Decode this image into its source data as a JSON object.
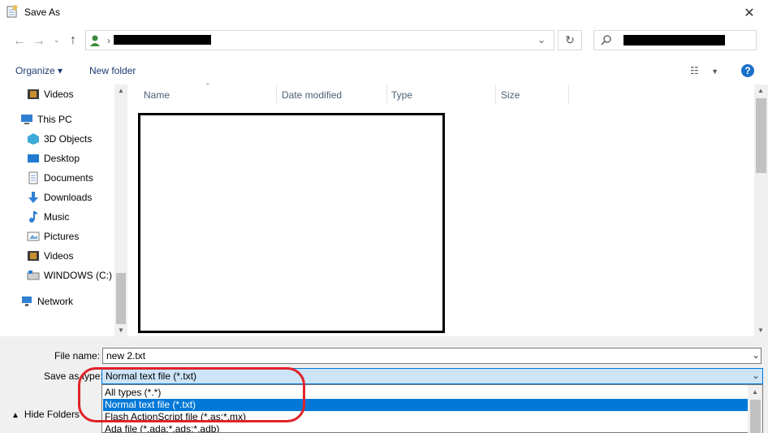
{
  "window": {
    "title": "Save As"
  },
  "columns": [
    "Name",
    "Date modified",
    "Type",
    "Size"
  ],
  "toolbar": {
    "organize": "Organize ▾",
    "new_folder": "New folder",
    "help": "?"
  },
  "nav": [
    {
      "label": "Videos",
      "icon": "videos-icon"
    },
    {
      "label": "This PC",
      "icon": "computer-icon"
    },
    {
      "label": "3D Objects",
      "icon": "3d-objects-icon"
    },
    {
      "label": "Desktop",
      "icon": "desktop-icon"
    },
    {
      "label": "Documents",
      "icon": "documents-icon"
    },
    {
      "label": "Downloads",
      "icon": "downloads-icon"
    },
    {
      "label": "Music",
      "icon": "music-icon"
    },
    {
      "label": "Pictures",
      "icon": "pictures-icon"
    },
    {
      "label": "Videos",
      "icon": "videos-icon"
    },
    {
      "label": "WINDOWS (C:)",
      "icon": "drive-icon"
    },
    {
      "label": "Network",
      "icon": "network-icon"
    }
  ],
  "form": {
    "file_name_label": "File name:",
    "file_name_value": "new 2.txt",
    "save_type_label": "Save as type:",
    "save_type_value": "Normal text file (*.txt)",
    "hide_folders": "Hide Folders"
  },
  "dropdown_options": [
    "All types (*.*)",
    "Normal text file (*.txt)",
    "Flash ActionScript file (*.as;*.mx)",
    "Ada file (*.ada;*.ads;*.adb)"
  ],
  "colors": {
    "accent": "#0078d7",
    "annotation": "#e0222a",
    "toolbar_text": "#1e3c73"
  }
}
